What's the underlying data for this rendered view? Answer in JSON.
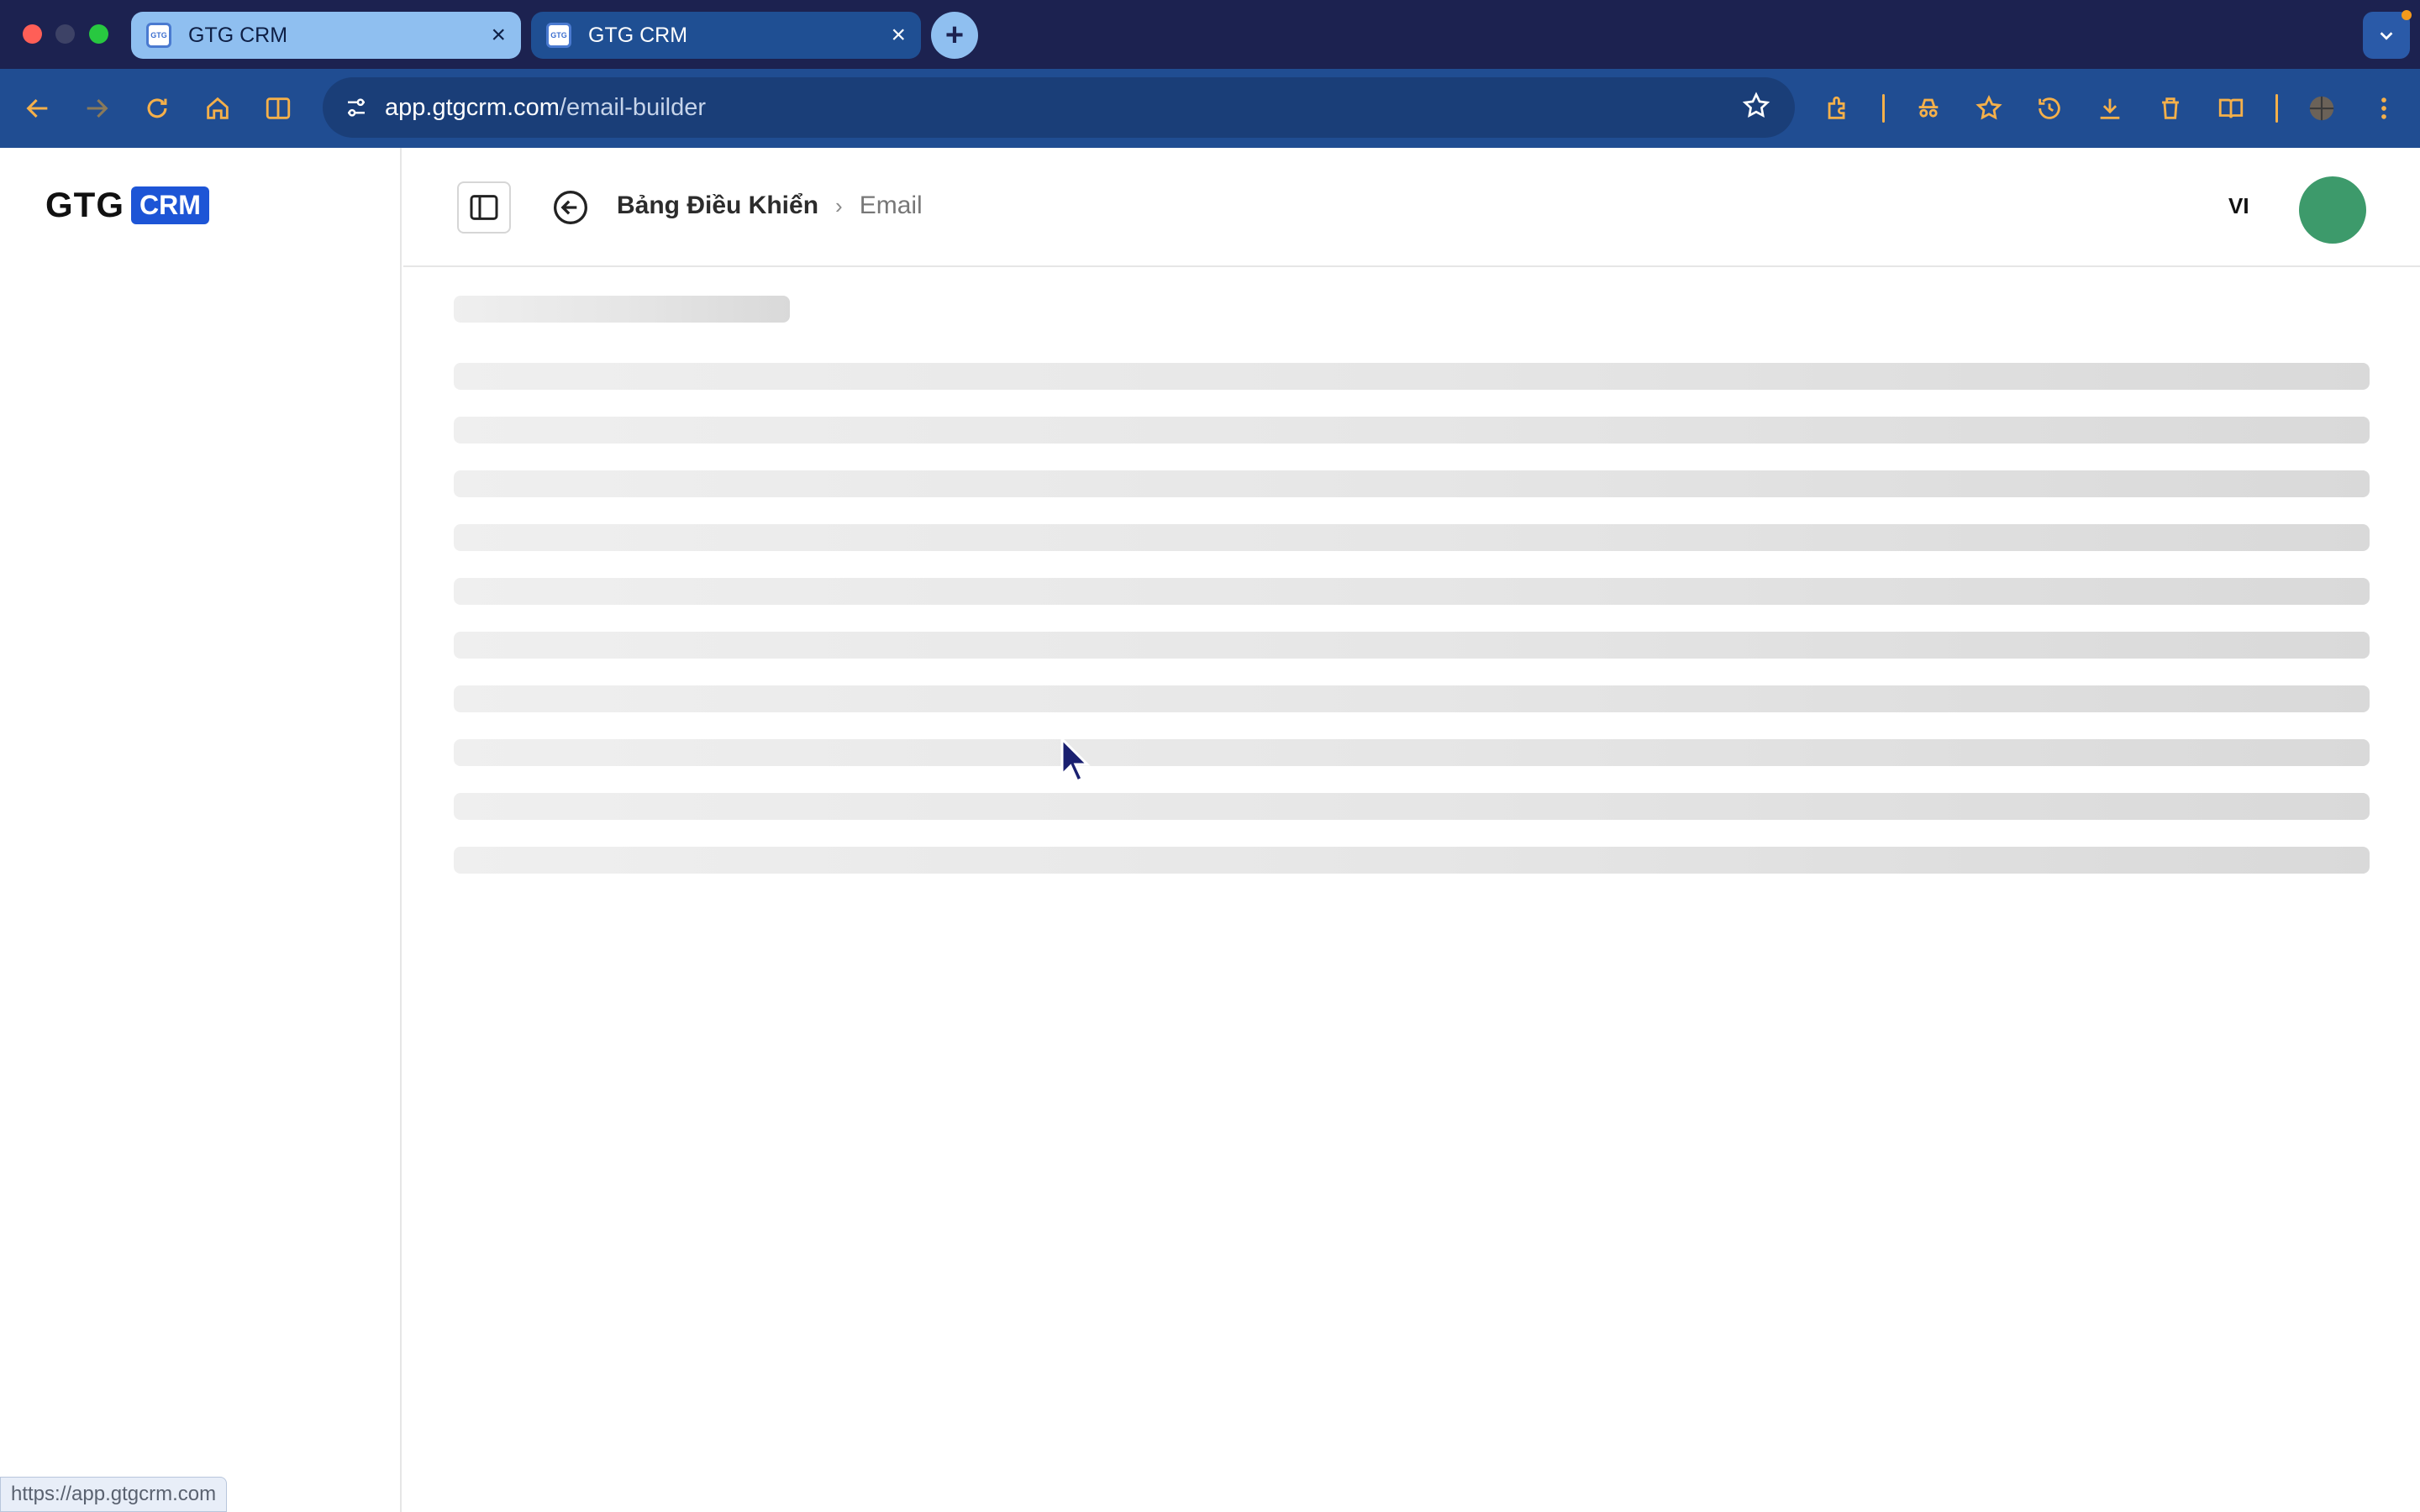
{
  "browser": {
    "tabs": [
      {
        "title": "GTG CRM",
        "active": false
      },
      {
        "title": "GTG CRM",
        "active": true
      }
    ],
    "url_domain": "app.gtgcrm.com",
    "url_path": "/email-builder",
    "status_url": "https://app.gtgcrm.com",
    "favicon_label": "GTG CRM"
  },
  "app": {
    "logo_text": "GTG",
    "logo_badge": "CRM",
    "breadcrumb": {
      "root": "Bảng Điều Khiển",
      "current": "Email"
    },
    "language": "VI",
    "avatar_color": "#3d9a6b",
    "accent": "#1d55d6"
  },
  "skeleton": {
    "line_count": 10
  },
  "icons": {
    "back": "arrow-left-icon",
    "forward": "arrow-right-icon",
    "reload": "reload-icon",
    "home": "home-icon",
    "split": "split-view-icon",
    "site_info": "tune-icon",
    "bookmark": "star-icon",
    "extensions": "puzzle-icon",
    "incognito": "incognito-icon",
    "favorites": "favorites-icon",
    "history": "history-icon",
    "downloads": "download-icon",
    "trash": "trash-icon",
    "reader": "reading-list-icon",
    "profile": "profile-icon",
    "menu": "more-vert-icon"
  }
}
